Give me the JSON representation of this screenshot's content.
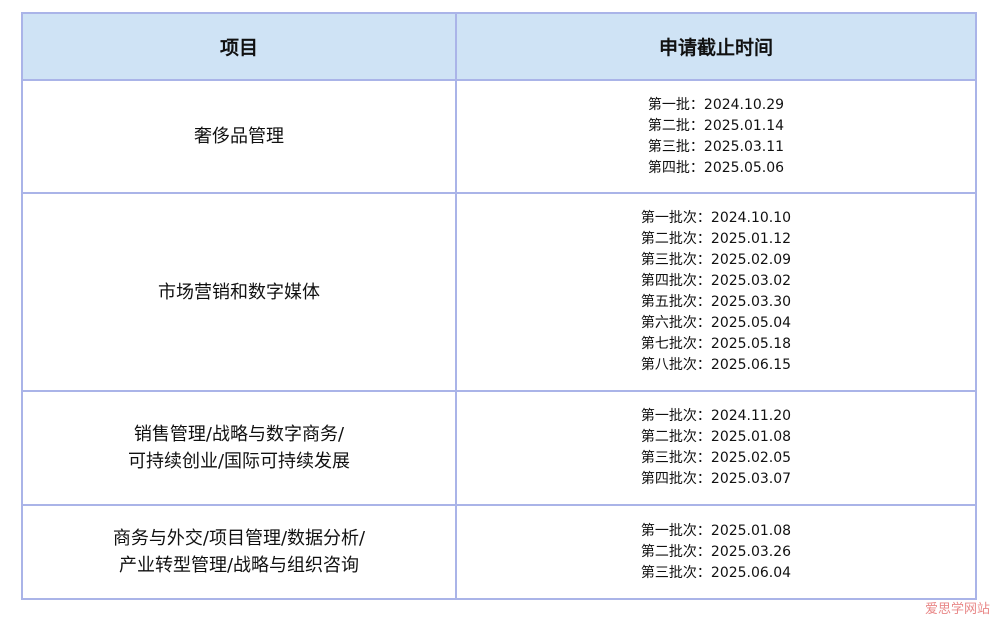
{
  "header": {
    "project": "项目",
    "deadline": "申请截止时间"
  },
  "rows": [
    {
      "project_lines": [
        "奢侈品管理"
      ],
      "dates": [
        "第一批：2024.10.29",
        "第二批：2025.01.14",
        "第三批：2025.03.11",
        "第四批：2025.05.06"
      ]
    },
    {
      "project_lines": [
        "市场营销和数字媒体"
      ],
      "dates": [
        "第一批次：2024.10.10",
        "第二批次：2025.01.12",
        "第三批次：2025.02.09",
        "第四批次：2025.03.02",
        "第五批次：2025.03.30",
        "第六批次：2025.05.04",
        "第七批次：2025.05.18",
        "第八批次：2025.06.15"
      ]
    },
    {
      "project_lines": [
        "销售管理/战略与数字商务/",
        "可持续创业/国际可持续发展"
      ],
      "dates": [
        "第一批次：2024.11.20",
        "第二批次：2025.01.08",
        "第三批次：2025.02.05",
        "第四批次：2025.03.07"
      ]
    },
    {
      "project_lines": [
        "商务与外交/项目管理/数据分析/",
        "产业转型管理/战略与组织咨询"
      ],
      "dates": [
        "第一批次：2025.01.08",
        "第二批次：2025.03.26",
        "第三批次：2025.06.04"
      ]
    }
  ],
  "footer_watermark": "爱思学网站"
}
